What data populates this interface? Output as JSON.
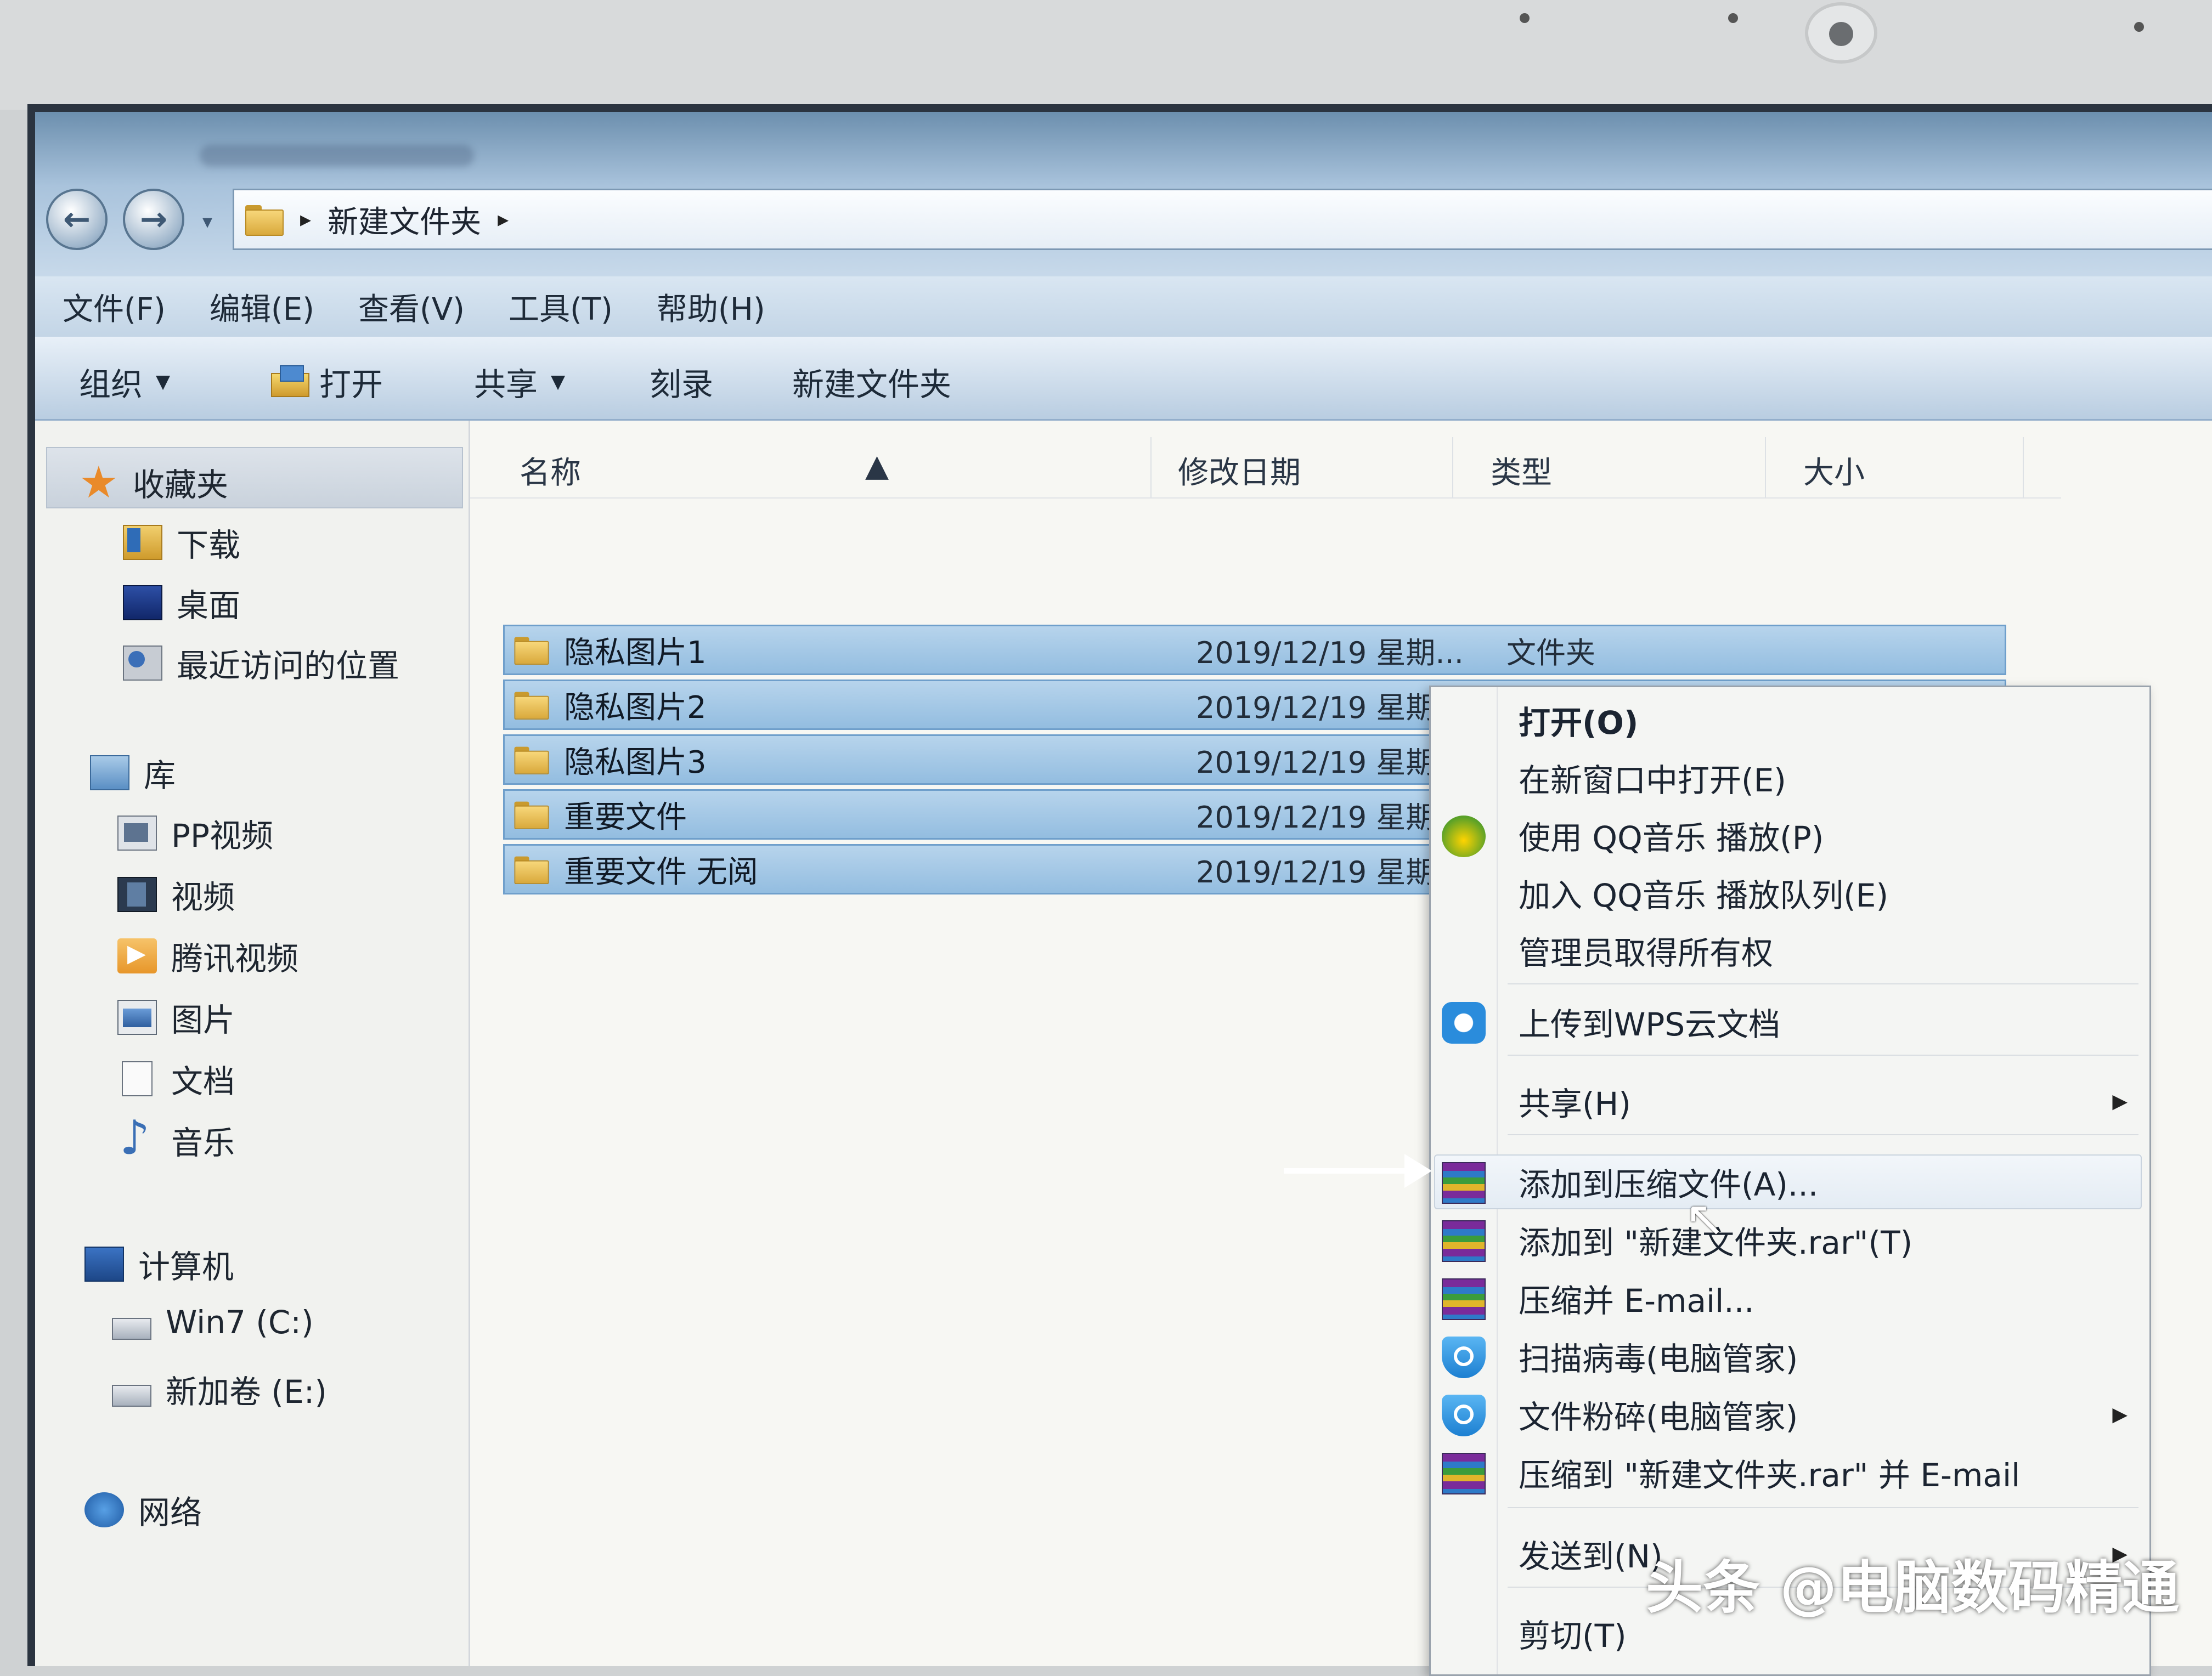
{
  "address": {
    "path": "新建文件夹"
  },
  "menubar": [
    "文件(F)",
    "编辑(E)",
    "查看(V)",
    "工具(T)",
    "帮助(H)"
  ],
  "toolbar": {
    "organize": "组织",
    "open": "打开",
    "share": "共享",
    "burn": "刻录",
    "new_folder": "新建文件夹"
  },
  "sidebar": {
    "favorites": {
      "label": "收藏夹",
      "items": [
        "下载",
        "桌面",
        "最近访问的位置"
      ]
    },
    "library": {
      "label": "库",
      "items": [
        "PP视频",
        "视频",
        "腾讯视频",
        "图片",
        "文档",
        "音乐"
      ]
    },
    "computer": {
      "label": "计算机",
      "items": [
        "Win7 (C:)",
        "新加卷 (E:)"
      ]
    },
    "network": {
      "label": "网络"
    }
  },
  "columns": {
    "name": "名称",
    "modified": "修改日期",
    "type": "类型",
    "size": "大小"
  },
  "files": [
    {
      "name": "隐私图片1",
      "date": "2019/12/19 星期...",
      "type": "文件夹"
    },
    {
      "name": "隐私图片2",
      "date": "2019/12/19 星期...",
      "type": "文件夹"
    },
    {
      "name": "隐私图片3",
      "date": "2019/12/19 星期...",
      "type": "文件夹"
    },
    {
      "name": "重要文件",
      "date": "2019/12/19 星期",
      "type": ""
    },
    {
      "name": "重要文件 无阅",
      "date": "2019/12/19 星期",
      "type": ""
    }
  ],
  "context_menu": {
    "open": "打开(O)",
    "open_new_window": "在新窗口中打开(E)",
    "qq_play": "使用 QQ音乐 播放(P)",
    "qq_queue": "加入 QQ音乐 播放队列(E)",
    "take_ownership": "管理员取得所有权",
    "wps_upload": "上传到WPS云文档",
    "share": "共享(H)",
    "add_archive": "添加到压缩文件(A)...",
    "add_to_rar": "添加到 \"新建文件夹.rar\"(T)",
    "compress_email": "压缩并 E-mail...",
    "scan_virus": "扫描病毒(电脑管家)",
    "shred": "文件粉碎(电脑管家)",
    "compress_rar_email": "压缩到 \"新建文件夹.rar\" 并 E-mail",
    "send_to": "发送到(N)",
    "cut": "剪切(T)"
  },
  "watermark": "头条 @电脑数码精通"
}
